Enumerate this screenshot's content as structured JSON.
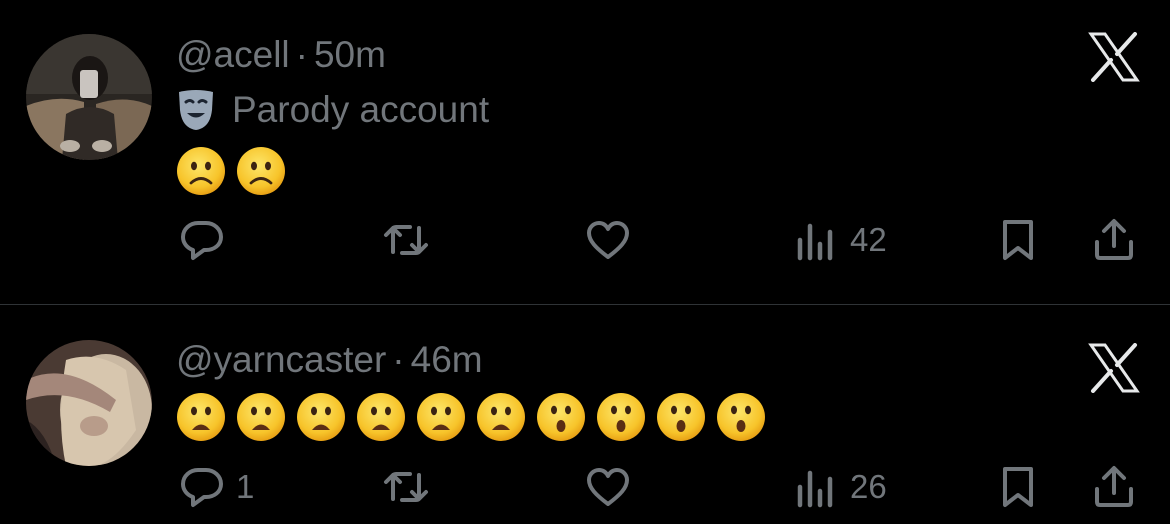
{
  "tweets": [
    {
      "handle": "@acell",
      "separator": "·",
      "time": "50m",
      "label": "Parody account",
      "label_icon": "theater-mask-icon",
      "emojis": [
        "slightly-frowning-face",
        "slightly-frowning-face"
      ],
      "reply_count": "",
      "views": "42"
    },
    {
      "handle": "@yarncaster",
      "separator": "·",
      "time": "46m",
      "emojis": [
        "frowning-face-open-mouth",
        "frowning-face-open-mouth",
        "frowning-face-open-mouth",
        "frowning-face-open-mouth",
        "frowning-face-open-mouth",
        "frowning-face-open-mouth",
        "hushed-face",
        "hushed-face",
        "hushed-face",
        "hushed-face"
      ],
      "reply_count": "1",
      "views": "26"
    }
  ],
  "icons": [
    "x-logo-icon",
    "reply-icon",
    "retweet-icon",
    "like-icon",
    "views-icon",
    "bookmark-icon",
    "share-icon"
  ],
  "colors": {
    "background": "#000000",
    "secondary_text": "#71767b",
    "divider": "#2f3336",
    "x_logo": "#e7e9ea",
    "emoji_yellow": "#f7c42a"
  }
}
